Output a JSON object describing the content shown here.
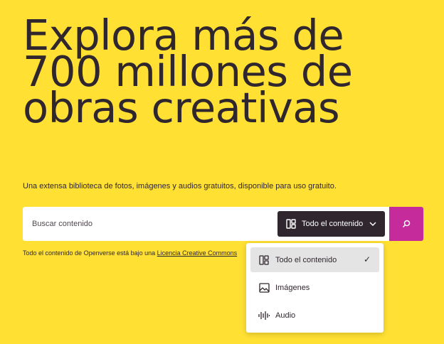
{
  "hero": {
    "line1": "Explora más de",
    "line2": "700 millones de",
    "line3": "obras creativas"
  },
  "subtitle": "Una extensa biblioteca de fotos, imágenes y audios gratuitos, disponible para uso gratuito.",
  "search": {
    "placeholder": "Buscar contenido",
    "type_button_label": "Todo el contenido"
  },
  "license": {
    "prefix": "Todo el contenido de Openverse está bajo una ",
    "link": "Licencia Creative Commons"
  },
  "content_menu": {
    "items": [
      {
        "label": "Todo el contenido",
        "icon": "all-content-icon",
        "selected": true
      },
      {
        "label": "Imágenes",
        "icon": "image-icon",
        "selected": false
      },
      {
        "label": "Audio",
        "icon": "audio-wave-icon",
        "selected": false
      }
    ],
    "check": "✓"
  },
  "colors": {
    "background": "#ffe033",
    "text": "#30272e",
    "button_dark": "#30272e",
    "search_accent": "#c52b9b"
  }
}
